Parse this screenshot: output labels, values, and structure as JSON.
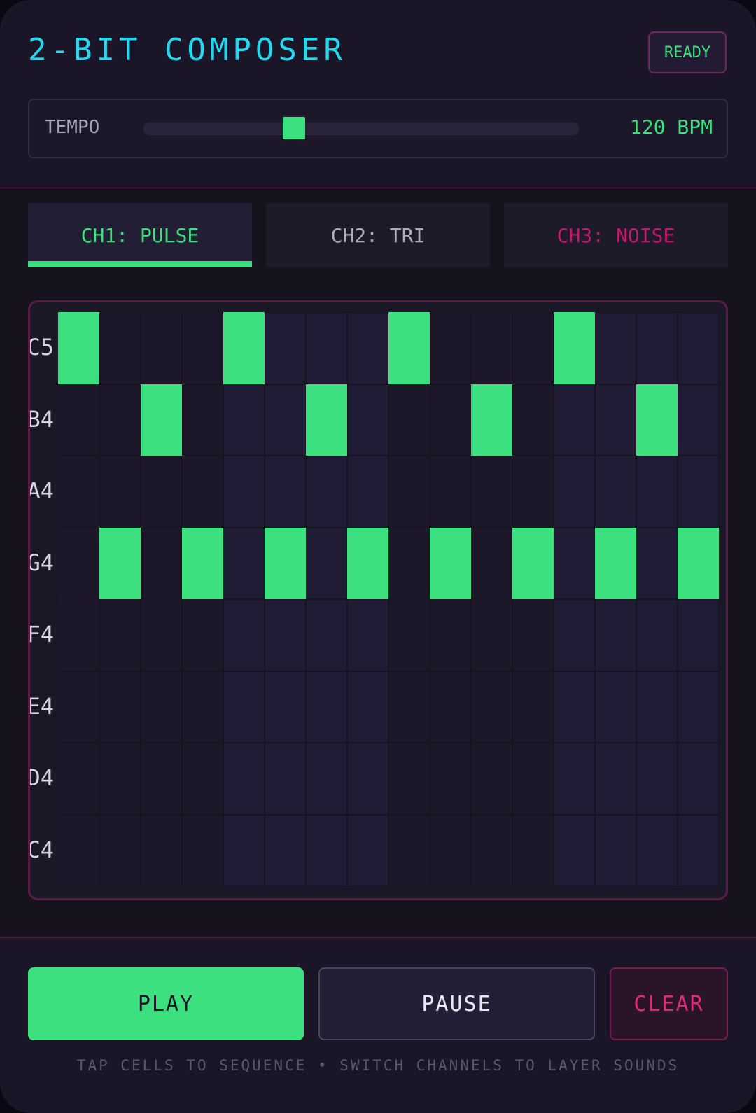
{
  "header": {
    "title": "2-BIT COMPOSER",
    "status": "READY"
  },
  "tempo": {
    "label": "TEMPO",
    "value_text": "120 BPM",
    "slider_fraction": 0.345
  },
  "tabs": [
    {
      "label": "CH1: PULSE",
      "color": "#3ce07e",
      "active": true
    },
    {
      "label": "CH2: TRI",
      "color": "#b0acbe",
      "active": false
    },
    {
      "label": "CH3: NOISE",
      "color": "#c4186a",
      "active": false
    }
  ],
  "sequencer": {
    "rows": [
      "C5",
      "B4",
      "A4",
      "G4",
      "F4",
      "E4",
      "D4",
      "C4"
    ],
    "steps": 16,
    "pattern": [
      [
        1,
        0,
        0,
        0,
        1,
        0,
        0,
        0,
        1,
        0,
        0,
        0,
        1,
        0,
        0,
        0
      ],
      [
        0,
        0,
        1,
        0,
        0,
        0,
        1,
        0,
        0,
        0,
        1,
        0,
        0,
        0,
        1,
        0
      ],
      [
        0,
        0,
        0,
        0,
        0,
        0,
        0,
        0,
        0,
        0,
        0,
        0,
        0,
        0,
        0,
        0
      ],
      [
        0,
        1,
        0,
        1,
        0,
        1,
        0,
        1,
        0,
        1,
        0,
        1,
        0,
        1,
        0,
        1
      ],
      [
        0,
        0,
        0,
        0,
        0,
        0,
        0,
        0,
        0,
        0,
        0,
        0,
        0,
        0,
        0,
        0
      ],
      [
        0,
        0,
        0,
        0,
        0,
        0,
        0,
        0,
        0,
        0,
        0,
        0,
        0,
        0,
        0,
        0
      ],
      [
        0,
        0,
        0,
        0,
        0,
        0,
        0,
        0,
        0,
        0,
        0,
        0,
        0,
        0,
        0,
        0
      ],
      [
        0,
        0,
        0,
        0,
        0,
        0,
        0,
        0,
        0,
        0,
        0,
        0,
        0,
        0,
        0,
        0
      ]
    ],
    "on_color": "#3ce07e",
    "beat_group_colors": [
      "#1c1829",
      "#211c35"
    ]
  },
  "controls": {
    "play_label": "PLAY",
    "pause_label": "PAUSE",
    "clear_label": "CLEAR",
    "hint": "TAP CELLS TO SEQUENCE • SWITCH CHANNELS TO LAYER SOUNDS"
  }
}
